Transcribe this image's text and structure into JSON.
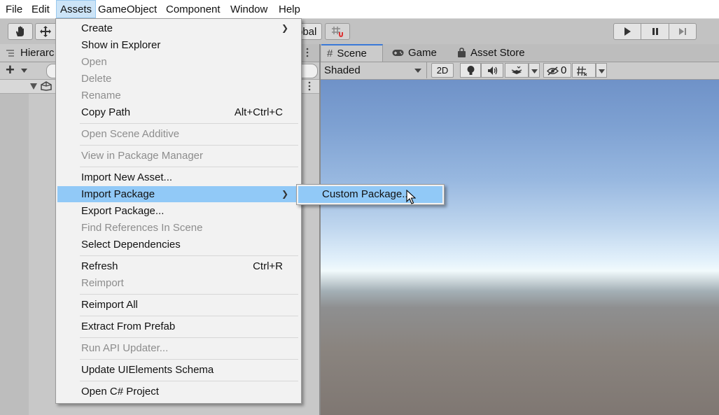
{
  "menubar": {
    "items": [
      "File",
      "Edit",
      "Assets",
      "GameObject",
      "Component",
      "Window",
      "Help"
    ],
    "active": "Assets"
  },
  "toolbar": {
    "pivot_partial": "obal",
    "icons": [
      "hand-tool-icon",
      "move-tool-icon",
      "grid-snap-icon",
      "play-icon",
      "pause-icon",
      "step-icon"
    ]
  },
  "hierarchy": {
    "tab_label": "Hierarc",
    "create_label": "+"
  },
  "scene": {
    "tabs": [
      {
        "label": "Scene",
        "icon": "hash-icon"
      },
      {
        "label": "Game",
        "icon": "gamepad-icon"
      },
      {
        "label": "Asset Store",
        "icon": "shopping-bag-icon"
      }
    ],
    "draw_mode": "Shaded",
    "mode_2d": "2D",
    "hidden_count": "0"
  },
  "assets_menu": {
    "items": [
      {
        "label": "Create",
        "submenu": true
      },
      {
        "label": "Show in Explorer"
      },
      {
        "label": "Open",
        "disabled": true
      },
      {
        "label": "Delete",
        "disabled": true
      },
      {
        "label": "Rename",
        "disabled": true
      },
      {
        "label": "Copy Path",
        "shortcut": "Alt+Ctrl+C"
      },
      {
        "label": "Open Scene Additive",
        "disabled": true
      },
      {
        "label": "View in Package Manager",
        "disabled": true
      },
      {
        "label": "Import New Asset..."
      },
      {
        "label": "Import Package",
        "submenu": true,
        "highlighted": true
      },
      {
        "label": "Export Package..."
      },
      {
        "label": "Find References In Scene",
        "disabled": true
      },
      {
        "label": "Select Dependencies"
      },
      {
        "label": "Refresh",
        "shortcut": "Ctrl+R"
      },
      {
        "label": "Reimport",
        "disabled": true
      },
      {
        "label": "Reimport All"
      },
      {
        "label": "Extract From Prefab"
      },
      {
        "label": "Run API Updater...",
        "disabled": true
      },
      {
        "label": "Update UIElements Schema"
      },
      {
        "label": "Open C# Project"
      }
    ]
  },
  "import_package_submenu": {
    "items": [
      {
        "label": "Custom Package..."
      }
    ]
  },
  "colors": {
    "menu_highlight": "#91c9f7",
    "menubar_active": "#cce4f7",
    "disabled_text": "#8d8d8d",
    "tab_accent": "#3a79d8"
  }
}
